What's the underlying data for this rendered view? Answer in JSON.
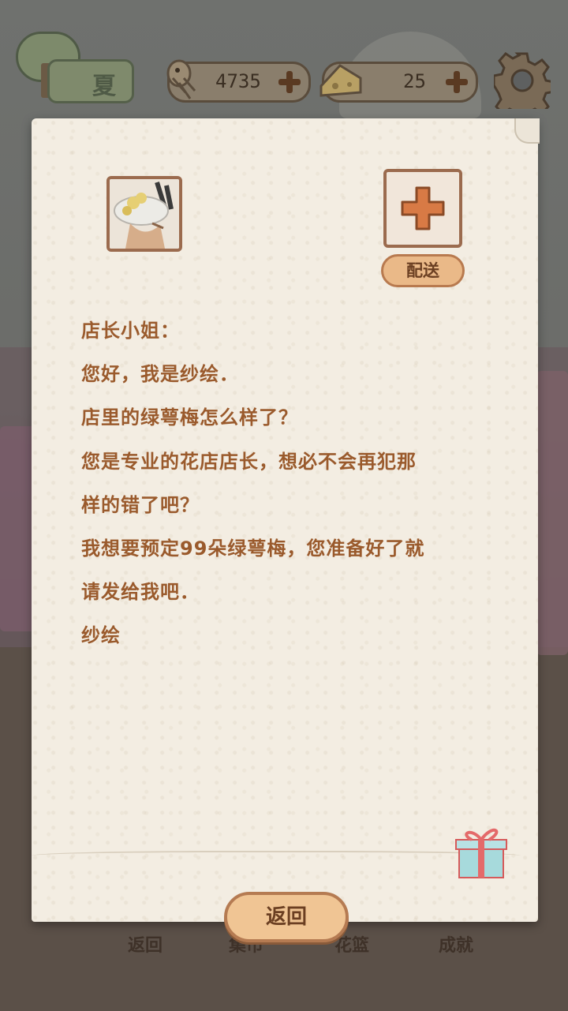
{
  "hud": {
    "season_label": "夏",
    "fish_count": "4735",
    "cheese_count": "25"
  },
  "letter": {
    "deliver_label": "配送",
    "lines": [
      "店长小姐：",
      "您好，我是纱绘．",
      "店里的绿萼梅怎么样了？",
      "您是专业的花店店长，想必不会再犯那",
      "样的错了吧？",
      "我想要预定99朵绿萼梅，您准备好了就",
      "请发给我吧．",
      "纱绘"
    ],
    "back_label": "返回"
  },
  "bottom_nav": {
    "items": [
      "返回",
      "集市",
      "花篮",
      "成就"
    ]
  },
  "colors": {
    "paper": "#f3ede2",
    "letter_text": "#9a5a2c",
    "button_fill": "#f0c594",
    "button_border": "#b57b52"
  }
}
